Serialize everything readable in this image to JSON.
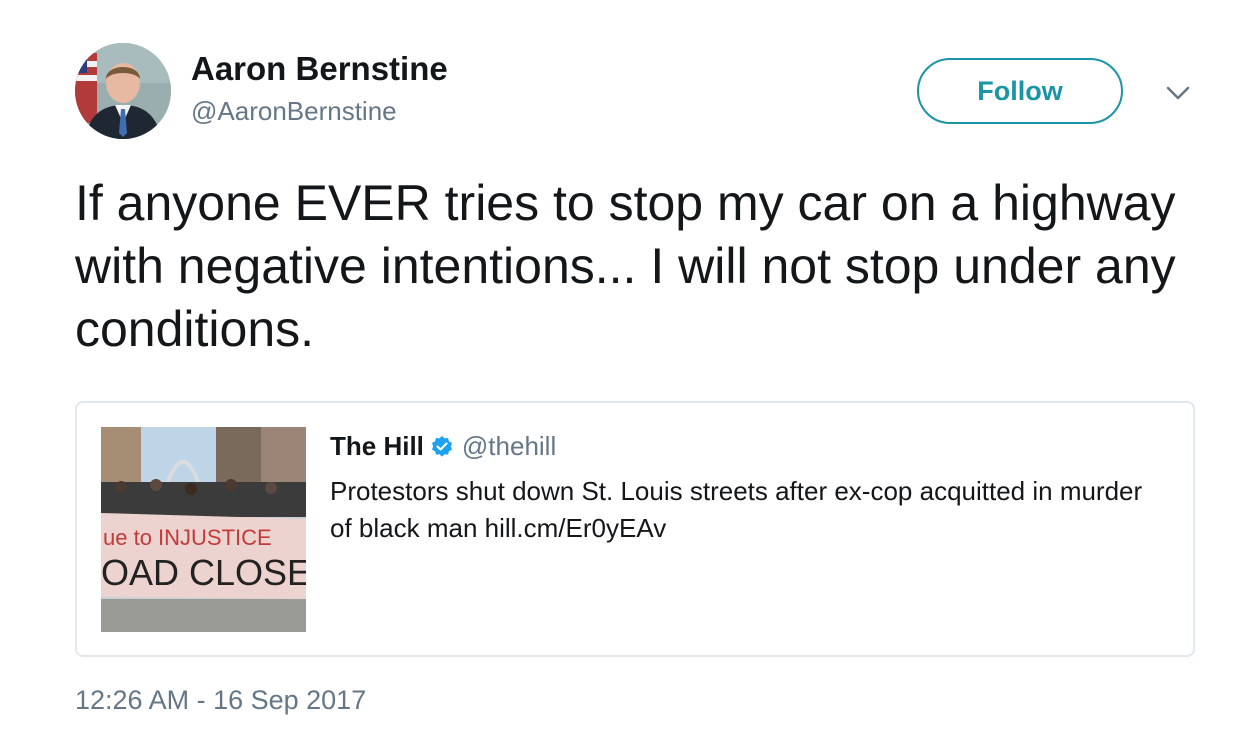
{
  "author": {
    "display_name": "Aaron Bernstine",
    "handle": "@AaronBernstine",
    "avatar_icon": "profile-photo"
  },
  "follow_button": {
    "label": "Follow",
    "color": "#1b95a5"
  },
  "menu_icon": "chevron-down-icon",
  "tweet": {
    "text": "If anyone EVER tries to stop my car on a highway with negative intentions... I will not stop under any conditions.",
    "timestamp": "12:26 AM - 16 Sep 2017"
  },
  "quoted_tweet": {
    "display_name": "The Hill",
    "verified": true,
    "verified_color": "#1da1f2",
    "handle": "@thehill",
    "text": "Protestors shut down St. Louis streets after ex-cop acquitted in murder of black man hill.cm/Er0yEAv",
    "thumbnail": {
      "banner_text_line1": "ue to  INJUSTICE",
      "banner_text_line2": "OAD CLOSED"
    }
  },
  "colors": {
    "primary_text": "#14171a",
    "secondary_text": "#657786",
    "card_border": "#e1e8ed"
  }
}
